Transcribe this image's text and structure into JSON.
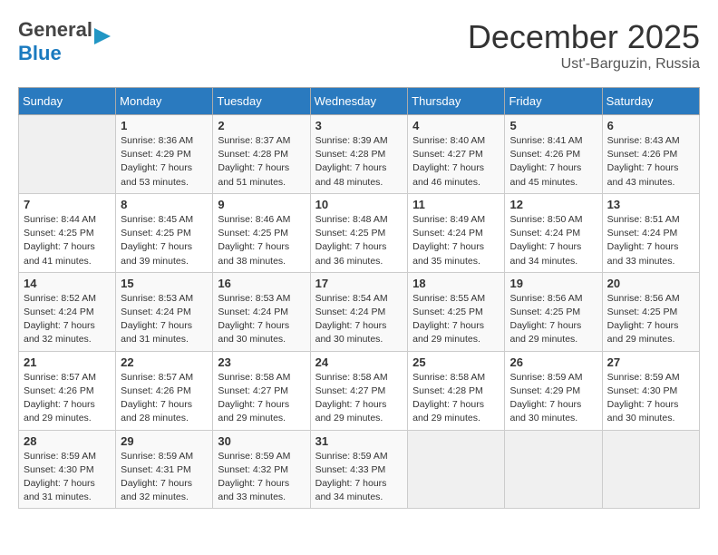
{
  "header": {
    "logo": {
      "line1_general": "General",
      "line1_blue": "Blue",
      "triangle": "▶"
    },
    "title": "December 2025",
    "location": "Ust'-Barguzin, Russia"
  },
  "calendar": {
    "weekdays": [
      "Sunday",
      "Monday",
      "Tuesday",
      "Wednesday",
      "Thursday",
      "Friday",
      "Saturday"
    ],
    "weeks": [
      [
        {
          "day": "",
          "sunrise": "",
          "sunset": "",
          "daylight": ""
        },
        {
          "day": "1",
          "sunrise": "Sunrise: 8:36 AM",
          "sunset": "Sunset: 4:29 PM",
          "daylight": "Daylight: 7 hours and 53 minutes."
        },
        {
          "day": "2",
          "sunrise": "Sunrise: 8:37 AM",
          "sunset": "Sunset: 4:28 PM",
          "daylight": "Daylight: 7 hours and 51 minutes."
        },
        {
          "day": "3",
          "sunrise": "Sunrise: 8:39 AM",
          "sunset": "Sunset: 4:28 PM",
          "daylight": "Daylight: 7 hours and 48 minutes."
        },
        {
          "day": "4",
          "sunrise": "Sunrise: 8:40 AM",
          "sunset": "Sunset: 4:27 PM",
          "daylight": "Daylight: 7 hours and 46 minutes."
        },
        {
          "day": "5",
          "sunrise": "Sunrise: 8:41 AM",
          "sunset": "Sunset: 4:26 PM",
          "daylight": "Daylight: 7 hours and 45 minutes."
        },
        {
          "day": "6",
          "sunrise": "Sunrise: 8:43 AM",
          "sunset": "Sunset: 4:26 PM",
          "daylight": "Daylight: 7 hours and 43 minutes."
        }
      ],
      [
        {
          "day": "7",
          "sunrise": "Sunrise: 8:44 AM",
          "sunset": "Sunset: 4:25 PM",
          "daylight": "Daylight: 7 hours and 41 minutes."
        },
        {
          "day": "8",
          "sunrise": "Sunrise: 8:45 AM",
          "sunset": "Sunset: 4:25 PM",
          "daylight": "Daylight: 7 hours and 39 minutes."
        },
        {
          "day": "9",
          "sunrise": "Sunrise: 8:46 AM",
          "sunset": "Sunset: 4:25 PM",
          "daylight": "Daylight: 7 hours and 38 minutes."
        },
        {
          "day": "10",
          "sunrise": "Sunrise: 8:48 AM",
          "sunset": "Sunset: 4:25 PM",
          "daylight": "Daylight: 7 hours and 36 minutes."
        },
        {
          "day": "11",
          "sunrise": "Sunrise: 8:49 AM",
          "sunset": "Sunset: 4:24 PM",
          "daylight": "Daylight: 7 hours and 35 minutes."
        },
        {
          "day": "12",
          "sunrise": "Sunrise: 8:50 AM",
          "sunset": "Sunset: 4:24 PM",
          "daylight": "Daylight: 7 hours and 34 minutes."
        },
        {
          "day": "13",
          "sunrise": "Sunrise: 8:51 AM",
          "sunset": "Sunset: 4:24 PM",
          "daylight": "Daylight: 7 hours and 33 minutes."
        }
      ],
      [
        {
          "day": "14",
          "sunrise": "Sunrise: 8:52 AM",
          "sunset": "Sunset: 4:24 PM",
          "daylight": "Daylight: 7 hours and 32 minutes."
        },
        {
          "day": "15",
          "sunrise": "Sunrise: 8:53 AM",
          "sunset": "Sunset: 4:24 PM",
          "daylight": "Daylight: 7 hours and 31 minutes."
        },
        {
          "day": "16",
          "sunrise": "Sunrise: 8:53 AM",
          "sunset": "Sunset: 4:24 PM",
          "daylight": "Daylight: 7 hours and 30 minutes."
        },
        {
          "day": "17",
          "sunrise": "Sunrise: 8:54 AM",
          "sunset": "Sunset: 4:24 PM",
          "daylight": "Daylight: 7 hours and 30 minutes."
        },
        {
          "day": "18",
          "sunrise": "Sunrise: 8:55 AM",
          "sunset": "Sunset: 4:25 PM",
          "daylight": "Daylight: 7 hours and 29 minutes."
        },
        {
          "day": "19",
          "sunrise": "Sunrise: 8:56 AM",
          "sunset": "Sunset: 4:25 PM",
          "daylight": "Daylight: 7 hours and 29 minutes."
        },
        {
          "day": "20",
          "sunrise": "Sunrise: 8:56 AM",
          "sunset": "Sunset: 4:25 PM",
          "daylight": "Daylight: 7 hours and 29 minutes."
        }
      ],
      [
        {
          "day": "21",
          "sunrise": "Sunrise: 8:57 AM",
          "sunset": "Sunset: 4:26 PM",
          "daylight": "Daylight: 7 hours and 29 minutes."
        },
        {
          "day": "22",
          "sunrise": "Sunrise: 8:57 AM",
          "sunset": "Sunset: 4:26 PM",
          "daylight": "Daylight: 7 hours and 28 minutes."
        },
        {
          "day": "23",
          "sunrise": "Sunrise: 8:58 AM",
          "sunset": "Sunset: 4:27 PM",
          "daylight": "Daylight: 7 hours and 29 minutes."
        },
        {
          "day": "24",
          "sunrise": "Sunrise: 8:58 AM",
          "sunset": "Sunset: 4:27 PM",
          "daylight": "Daylight: 7 hours and 29 minutes."
        },
        {
          "day": "25",
          "sunrise": "Sunrise: 8:58 AM",
          "sunset": "Sunset: 4:28 PM",
          "daylight": "Daylight: 7 hours and 29 minutes."
        },
        {
          "day": "26",
          "sunrise": "Sunrise: 8:59 AM",
          "sunset": "Sunset: 4:29 PM",
          "daylight": "Daylight: 7 hours and 30 minutes."
        },
        {
          "day": "27",
          "sunrise": "Sunrise: 8:59 AM",
          "sunset": "Sunset: 4:30 PM",
          "daylight": "Daylight: 7 hours and 30 minutes."
        }
      ],
      [
        {
          "day": "28",
          "sunrise": "Sunrise: 8:59 AM",
          "sunset": "Sunset: 4:30 PM",
          "daylight": "Daylight: 7 hours and 31 minutes."
        },
        {
          "day": "29",
          "sunrise": "Sunrise: 8:59 AM",
          "sunset": "Sunset: 4:31 PM",
          "daylight": "Daylight: 7 hours and 32 minutes."
        },
        {
          "day": "30",
          "sunrise": "Sunrise: 8:59 AM",
          "sunset": "Sunset: 4:32 PM",
          "daylight": "Daylight: 7 hours and 33 minutes."
        },
        {
          "day": "31",
          "sunrise": "Sunrise: 8:59 AM",
          "sunset": "Sunset: 4:33 PM",
          "daylight": "Daylight: 7 hours and 34 minutes."
        },
        {
          "day": "",
          "sunrise": "",
          "sunset": "",
          "daylight": ""
        },
        {
          "day": "",
          "sunrise": "",
          "sunset": "",
          "daylight": ""
        },
        {
          "day": "",
          "sunrise": "",
          "sunset": "",
          "daylight": ""
        }
      ]
    ]
  }
}
